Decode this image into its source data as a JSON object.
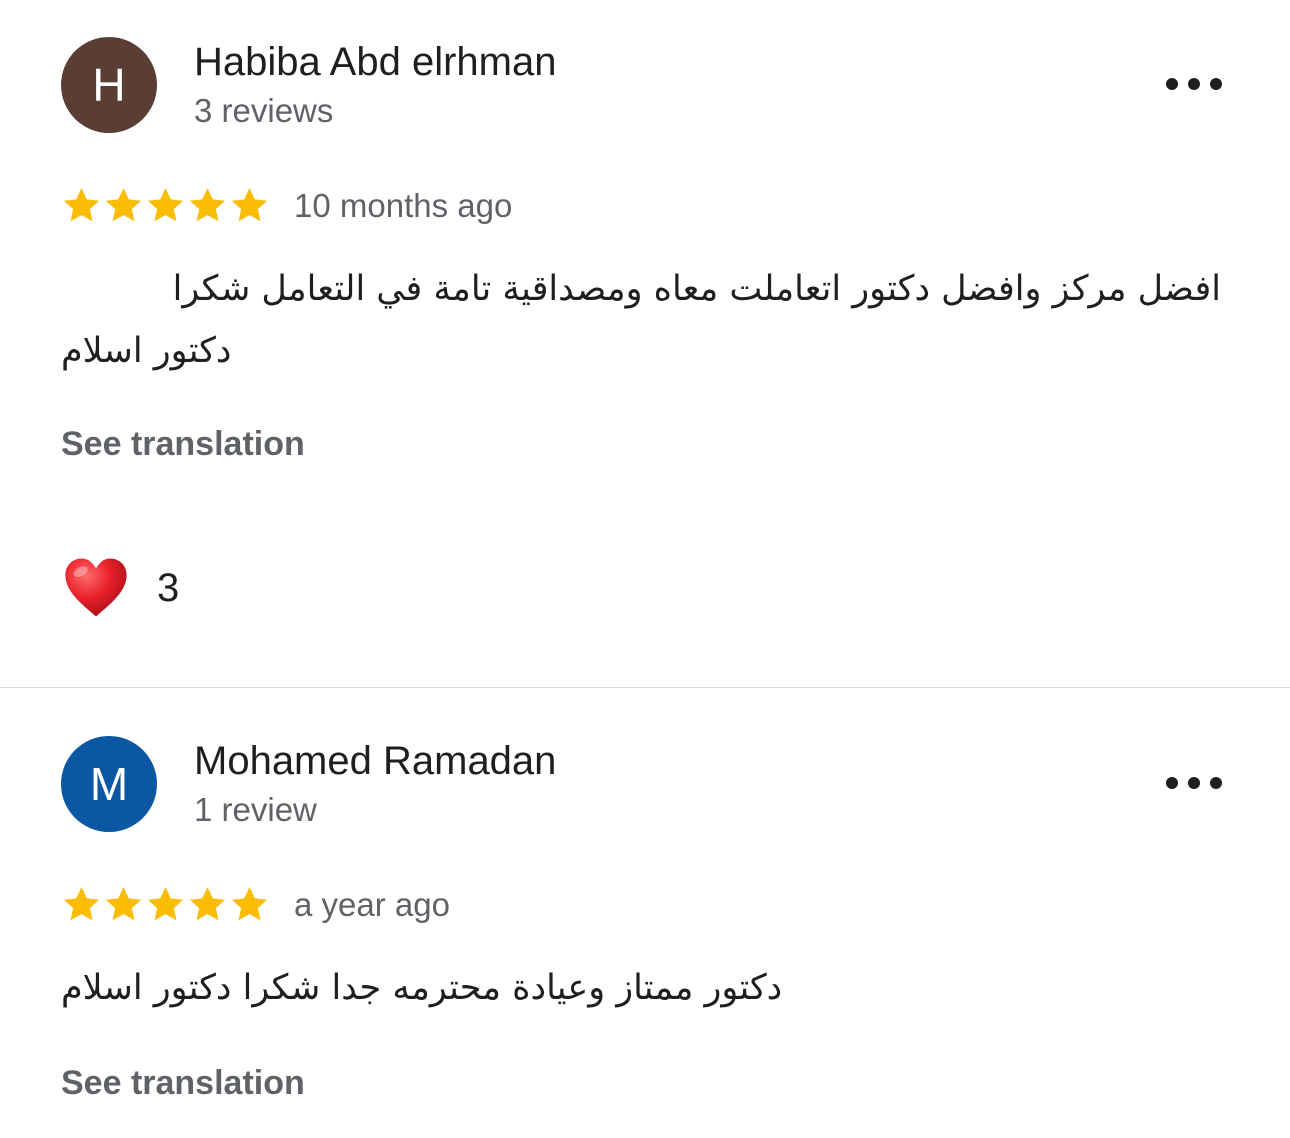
{
  "colors": {
    "star": "#fbbc04",
    "heart": "#e8202a",
    "secondary_text": "#5f6368",
    "divider": "#dadce0"
  },
  "reviews": [
    {
      "avatar_letter": "H",
      "avatar_color": "#5a3d33",
      "name": "Habiba Abd elrhman",
      "review_count": "3 reviews",
      "rating": 5,
      "date": "10 months ago",
      "text_line_1": "افضل مركز وافضل دكتور اتعاملت معاه ومصداقية تامة في التعامل شكرا",
      "text_line_2": "دكتور اسلام",
      "translate_label": "See translation",
      "reaction_icon": "heart-icon",
      "reaction_count": "3"
    },
    {
      "avatar_letter": "M",
      "avatar_color": "#0b57a4",
      "name": "Mohamed Ramadan",
      "review_count": "1 review",
      "rating": 5,
      "date": "a year ago",
      "text": "دكتور ممتاز وعيادة محترمه جدا شكرا دكتور اسلام",
      "translate_label": "See translation"
    }
  ]
}
